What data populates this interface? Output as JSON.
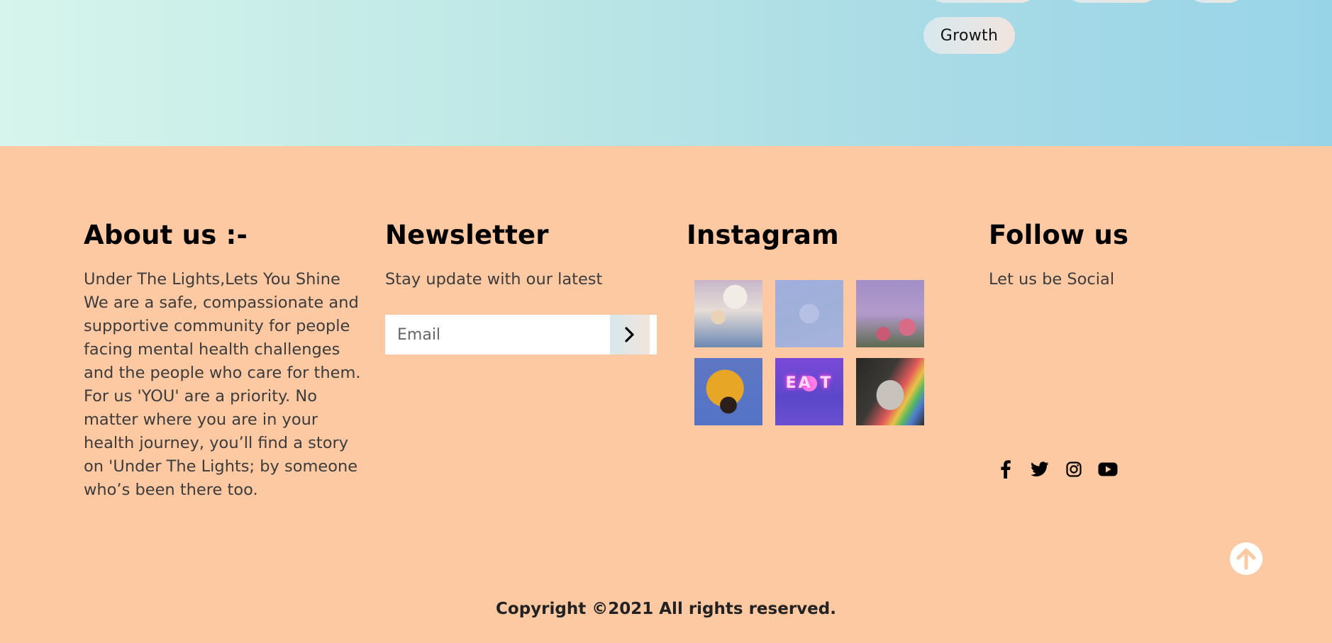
{
  "tags": {
    "visible_label": "Growth"
  },
  "about": {
    "heading": "About us :-",
    "text": "Under The Lights,Lets You Shine We are a safe, compassionate and supportive community for people facing mental health challenges and the people who care for them. For us 'YOU' are a priority. No matter where you are in your health journey, you’ll find a story on 'Under The Lights; by someone who’s been there too."
  },
  "newsletter": {
    "heading": "Newsletter",
    "text": "Stay update with our latest",
    "email_placeholder": "Email",
    "email_value": "",
    "submit_icon": "chevron-right-icon"
  },
  "instagram": {
    "heading": "Instagram",
    "tiles": [
      {
        "name": "instagram-photo-1"
      },
      {
        "name": "instagram-photo-2"
      },
      {
        "name": "instagram-photo-3"
      },
      {
        "name": "instagram-photo-4"
      },
      {
        "name": "instagram-photo-5",
        "neon_text": "EA T"
      },
      {
        "name": "instagram-photo-6"
      }
    ]
  },
  "follow": {
    "heading": "Follow us",
    "text": "Let us be Social",
    "icons": [
      "facebook-icon",
      "twitter-icon",
      "instagram-icon",
      "youtube-icon"
    ]
  },
  "back_to_top_icon": "arrow-up-icon",
  "copyright": "Copyright ©2021 All rights reserved.",
  "colors": {
    "footer_bg": "#fdc9a3",
    "band_start": "#d6f5ec",
    "band_end": "#98d4e8",
    "to_top_arrow": "#fdc9a3"
  }
}
